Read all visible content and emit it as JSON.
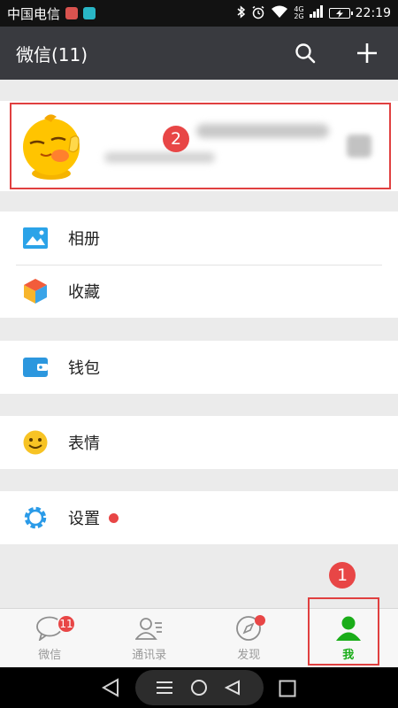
{
  "status_bar": {
    "carrier": "中国电信",
    "time": "22:19",
    "network_top": "4G",
    "network_bottom": "2G"
  },
  "header": {
    "title": "微信(11)",
    "search_icon": "search-icon",
    "add_icon": "plus-icon"
  },
  "profile": {
    "avatar_icon": "qq-mascot-avatar"
  },
  "annotations": {
    "callout_profile": "2",
    "callout_me_tab": "1"
  },
  "menu": {
    "album": "相册",
    "favorites": "收藏",
    "wallet": "钱包",
    "stickers": "表情",
    "settings": "设置"
  },
  "tabs": {
    "chats": "微信",
    "chats_badge": "11",
    "contacts": "通讯录",
    "discover": "发现",
    "me": "我"
  },
  "colors": {
    "header_bg": "#393a3f",
    "accent_green": "#1aad19",
    "badge_red": "#e84646",
    "annotation_red": "#e04040",
    "album_blue": "#2ba3e8",
    "wallet_blue": "#2c97de",
    "sticker_yellow": "#f7c324"
  }
}
